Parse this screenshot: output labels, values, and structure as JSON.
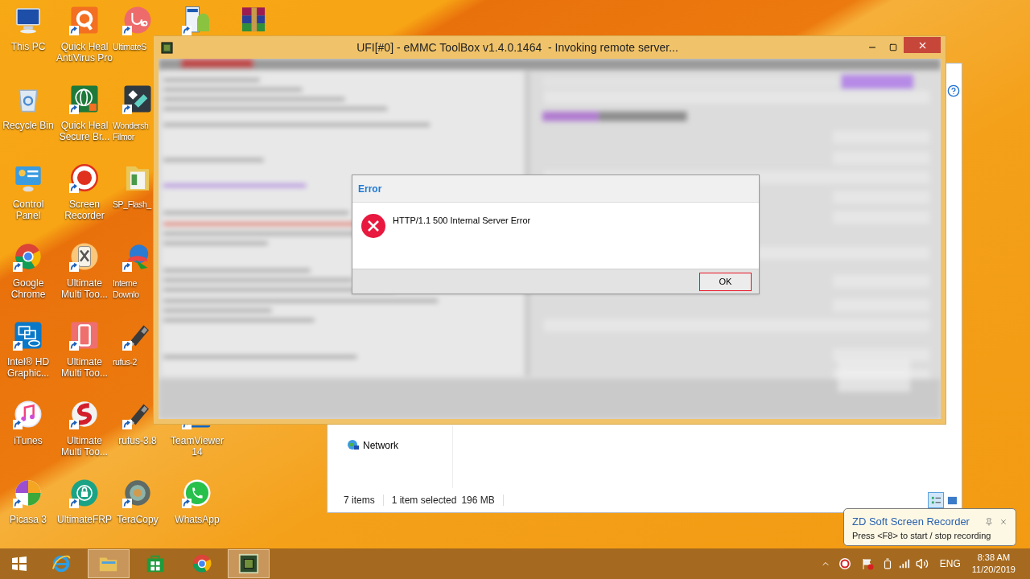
{
  "desktop": {
    "columns": [
      {
        "icons": [
          {
            "label": "This PC",
            "kind": "pc",
            "shortcut": false
          },
          {
            "label": "Recycle Bin",
            "kind": "recycle",
            "shortcut": false
          },
          {
            "label": "Control Panel",
            "kind": "control",
            "shortcut": false
          },
          {
            "label": "Google Chrome",
            "kind": "chrome",
            "shortcut": true
          },
          {
            "label": "Intel® HD Graphic...",
            "kind": "intel",
            "shortcut": true
          },
          {
            "label": "iTunes",
            "kind": "itunes",
            "shortcut": true
          },
          {
            "label": "Picasa 3",
            "kind": "picasa",
            "shortcut": true
          }
        ]
      },
      {
        "icons": [
          {
            "label": "Quick Heal AntiVirus Pro",
            "kind": "quickheal",
            "shortcut": true
          },
          {
            "label": "Quick Heal Secure Br...",
            "kind": "globe",
            "shortcut": true
          },
          {
            "label": "Screen Recorder",
            "kind": "recorder",
            "shortcut": true
          },
          {
            "label": "Ultimate Multi Too...",
            "kind": "tools",
            "shortcut": true
          },
          {
            "label": "Ultimate Multi Too...",
            "kind": "phone",
            "shortcut": true
          },
          {
            "label": "Ultimate Multi Too...",
            "kind": "snap",
            "shortcut": true
          },
          {
            "label": "UltimateFRP",
            "kind": "lock",
            "shortcut": true
          }
        ]
      },
      {
        "icons": [
          {
            "label": "UltimateS",
            "kind": "stethoscope",
            "shortcut": true,
            "clipped": true
          },
          {
            "label": "Wondersh Filmor",
            "kind": "filmora",
            "shortcut": true,
            "clipped": true
          },
          {
            "label": "SP_Flash_",
            "kind": "folder",
            "shortcut": false,
            "clipped": true
          },
          {
            "label": "Interne Downlo",
            "kind": "idm",
            "shortcut": true,
            "clipped": true
          },
          {
            "label": "rufus-2",
            "kind": "usb",
            "shortcut": true,
            "clipped": true
          },
          {
            "label": "rufus-3.8",
            "kind": "usb",
            "shortcut": true
          },
          {
            "label": "TeraCopy",
            "kind": "teracopy",
            "shortcut": true
          }
        ]
      },
      {
        "icons": [
          {
            "kind": "ufi",
            "shortcut": true
          }
        ],
        "lower_icons": [
          {
            "label": "TeamViewer 14",
            "kind": "teamviewer",
            "shortcut": true
          },
          {
            "label": "WhatsApp",
            "kind": "whatsapp",
            "shortcut": true
          }
        ]
      },
      {
        "icons": [
          {
            "kind": "winrar",
            "shortcut": false
          }
        ]
      }
    ]
  },
  "explorer": {
    "nav_items": [
      {
        "label": "Network"
      }
    ],
    "status_bar": {
      "count": "7 items",
      "selection": "1 item selected",
      "size": "196 MB"
    },
    "views": [
      {
        "kind": "details",
        "selected": true
      },
      {
        "kind": "large",
        "selected": false
      }
    ]
  },
  "window": {
    "title": "UFI[#0] - eMMC ToolBox v1.4.0.1464  - Invoking remote server..."
  },
  "dialog": {
    "title": "Error",
    "message": "HTTP/1.1 500 Internal Server Error",
    "buttons": [
      "OK"
    ]
  },
  "notification": {
    "title": "ZD Soft Screen Recorder",
    "text": "Press <F8> to start / stop recording"
  },
  "taskbar": {
    "apps": [
      {
        "kind": "ie",
        "open": false
      },
      {
        "kind": "explorer",
        "open": true
      },
      {
        "kind": "store",
        "open": false
      },
      {
        "kind": "chrome",
        "open": false
      },
      {
        "kind": "ufi",
        "open": true
      }
    ],
    "tray": {
      "language": "ENG",
      "time": "8:38 AM",
      "date": "11/20/2019"
    }
  }
}
